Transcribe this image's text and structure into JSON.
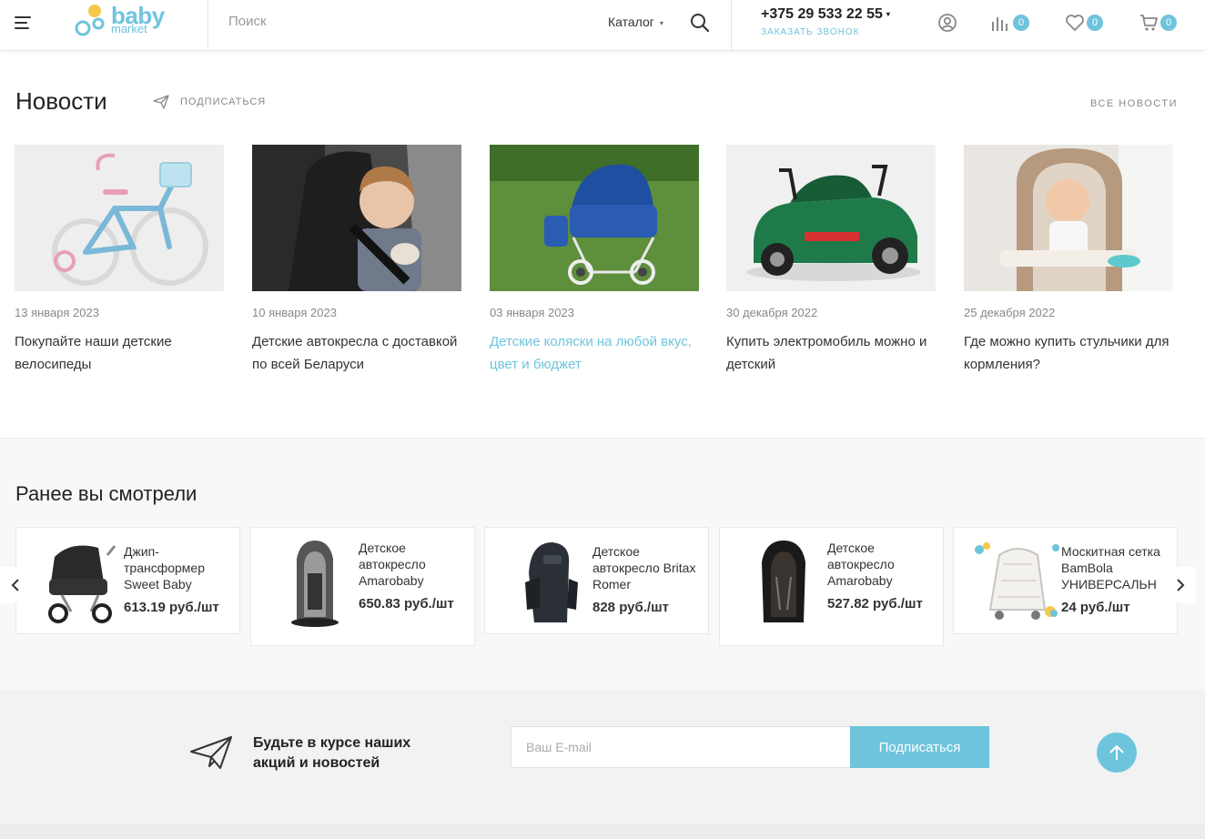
{
  "header": {
    "logo_main": "baby",
    "logo_sub": "market",
    "search_placeholder": "Поиск",
    "catalog_label": "Каталог",
    "phone": "+375 29 533 22 55",
    "callback_label": "Заказать звонок",
    "compare_count": "0",
    "favorites_count": "0",
    "cart_count": "0"
  },
  "news": {
    "title": "Новости",
    "subscribe_label": "Подписаться",
    "all_label": "Все новости",
    "items": [
      {
        "date": "13 января 2023",
        "title": "Покупайте наши детские велосипеды",
        "image": "bicycle"
      },
      {
        "date": "10 января 2023",
        "title": "Детские автокресла с доставкой по всей Беларуси",
        "image": "car-seat-child"
      },
      {
        "date": "03 января 2023",
        "title": "Детские коляски на любой вкус, цвет и бюджет",
        "image": "stroller"
      },
      {
        "date": "30 декабря 2022",
        "title": "Купить электромобиль можно и детский",
        "image": "electric-car"
      },
      {
        "date": "25 декабря 2022",
        "title": "Где можно купить стульчики для кормления?",
        "image": "high-chair"
      }
    ]
  },
  "viewed": {
    "title": "Ранее вы смотрели",
    "items": [
      {
        "name": "Джип-трансформер Sweet Baby",
        "price": "613.19 руб./шт"
      },
      {
        "name": "Детское автокресло Amarobaby",
        "price": "650.83 руб./шт"
      },
      {
        "name": "Детское автокресло Britax Romer",
        "price": "828 руб./шт"
      },
      {
        "name": "Детское автокресло Amarobaby",
        "price": "527.82 руб./шт"
      },
      {
        "name": "Москитная сетка BamBola УНИВЕРСАЛЬН",
        "price": "24 руб./шт"
      }
    ]
  },
  "subscribe": {
    "text": "Будьте в курсе наших акций и новостей",
    "email_placeholder": "Ваш E-mail",
    "button_label": "Подписаться"
  },
  "colors": {
    "accent": "#6ec4dc",
    "text": "#333333",
    "muted": "#888888"
  }
}
